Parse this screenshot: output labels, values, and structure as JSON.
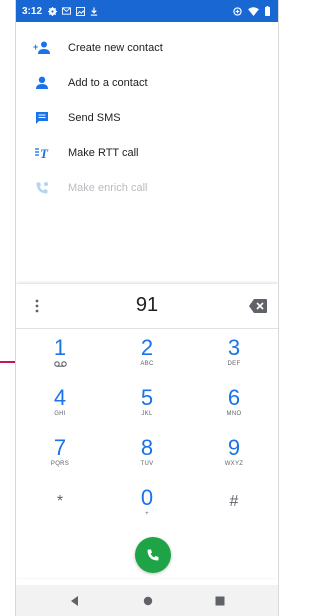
{
  "status_bar": {
    "time": "3:12",
    "left_icons": [
      "gear-icon",
      "mail-icon",
      "image-icon",
      "download-icon"
    ],
    "right_icons": [
      "data-saver-icon",
      "wifi-icon",
      "battery-icon"
    ]
  },
  "actions": [
    {
      "label": "Create new contact",
      "icon": "add-person-icon",
      "enabled": true
    },
    {
      "label": "Add to a contact",
      "icon": "person-icon",
      "enabled": true
    },
    {
      "label": "Send SMS",
      "icon": "message-icon",
      "enabled": true
    },
    {
      "label": "Make RTT call",
      "icon": "rtt-icon",
      "enabled": true
    },
    {
      "label": "Make enrich call",
      "icon": "enrich-call-icon",
      "enabled": false
    }
  ],
  "dialer": {
    "digits": "91",
    "keys": [
      {
        "num": "1",
        "letters": ""
      },
      {
        "num": "2",
        "letters": "ABC"
      },
      {
        "num": "3",
        "letters": "DEF"
      },
      {
        "num": "4",
        "letters": "GHI"
      },
      {
        "num": "5",
        "letters": "JKL"
      },
      {
        "num": "6",
        "letters": "MNO"
      },
      {
        "num": "7",
        "letters": "PQRS"
      },
      {
        "num": "8",
        "letters": "TUV"
      },
      {
        "num": "9",
        "letters": "WXYZ"
      },
      {
        "num": "*",
        "letters": ""
      },
      {
        "num": "0",
        "letters": "+"
      },
      {
        "num": "#",
        "letters": ""
      }
    ]
  },
  "colors": {
    "accent": "#1a73e8",
    "status_bar": "#1967d2",
    "call_button": "#1ea446",
    "annotation": "#c2185b"
  }
}
